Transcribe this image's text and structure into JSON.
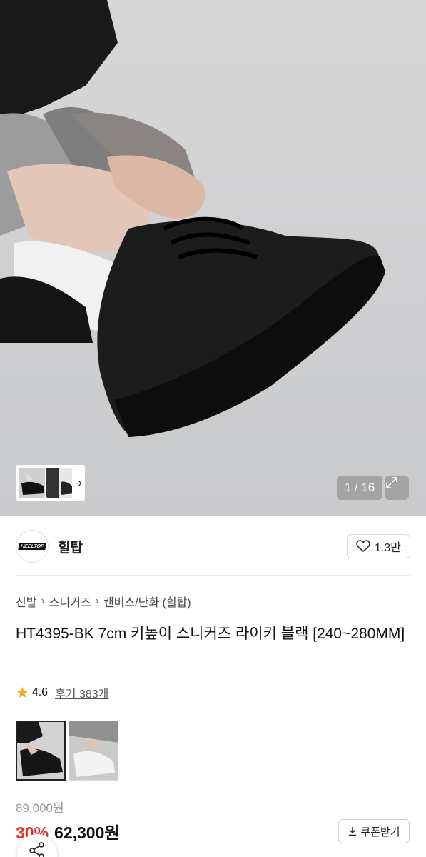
{
  "gallery": {
    "counter": "1 / 16",
    "expand_icon": "expand-icon",
    "thumbnail_arrow": "chevron-right-icon"
  },
  "brand": {
    "logo_text": "HEELTOP",
    "name": "힐탑",
    "like_count": "1.3만"
  },
  "breadcrumb": [
    "신발",
    "스니커즈",
    "캔버스/단화 (힐탑)"
  ],
  "product": {
    "title": "HT4395-BK 7cm 키높이 스니커즈 라이키 블랙 [240~280MM]",
    "rating": "4.6",
    "review_label": "후기 383개",
    "original_price": "89,000원",
    "discount": "30%",
    "price": "62,300원"
  },
  "actions": {
    "coupon_label": "쿠폰받기"
  },
  "colors": {
    "discount": "#e5312c",
    "star": "#f5a623"
  }
}
